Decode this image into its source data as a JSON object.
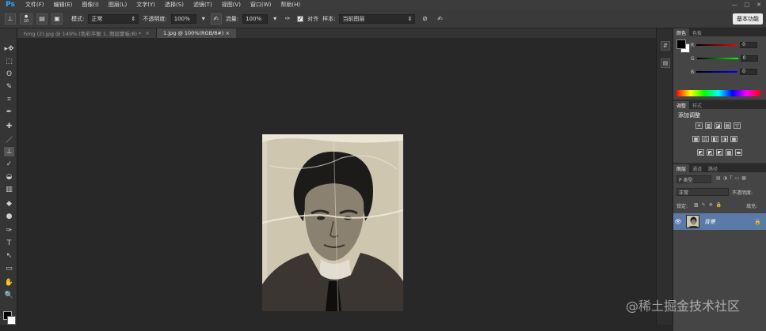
{
  "app": {
    "logo": "Ps"
  },
  "menu": {
    "items": [
      "文件(F)",
      "编辑(E)",
      "图像(I)",
      "图层(L)",
      "文字(Y)",
      "选择(S)",
      "滤镜(T)",
      "视图(V)",
      "窗口(W)",
      "帮助(H)"
    ]
  },
  "window_controls": [
    "—",
    "□",
    "✕"
  ],
  "options": {
    "brush_size": "10",
    "mode_label": "模式:",
    "mode_value": "正常",
    "opacity_label": "不透明度:",
    "opacity_value": "100%",
    "flow_label": "流量:",
    "flow_value": "100%",
    "aligned_label": "对齐",
    "sample_label": "样本:",
    "sample_value": "当前图层",
    "workspace_button": "基本功能"
  },
  "doc_tabs": [
    {
      "label": "hmg (2).jpg @ 149% (色彩平衡 1, 图层蒙板/8) *",
      "close": "×"
    },
    {
      "label": "1.jpg @ 100%(RGB/8#)",
      "close": "×"
    }
  ],
  "color_panel": {
    "tabs": [
      "颜色",
      "色板"
    ],
    "sliders": [
      {
        "channel": "R",
        "value": "0",
        "color": "#d03030"
      },
      {
        "channel": "G",
        "value": "0",
        "color": "#30b030"
      },
      {
        "channel": "B",
        "value": "0",
        "color": "#3040d0"
      }
    ]
  },
  "adjustments_panel": {
    "tabs": [
      "调整",
      "样式"
    ],
    "title": "添加调整",
    "row1": [
      "☀",
      "▥",
      "◪",
      "▤",
      "▽"
    ],
    "row2": [
      "▦",
      "⚖",
      "◧",
      "◑",
      "▦"
    ],
    "row3": [
      "◩",
      "◩",
      "◩",
      "▩",
      "▬"
    ]
  },
  "layers_panel": {
    "tabs": [
      "图层",
      "通道",
      "路径"
    ],
    "filter_label": "P 类型",
    "blend_mode": "正常",
    "opacity_label": "不透明度:",
    "lock_label": "锁定:",
    "fill_label": "填充:",
    "layer_name": "背景"
  },
  "toolbox": {
    "tools": [
      "▸✥",
      "⬚",
      "ʘ",
      "✎",
      "⌗",
      "✒",
      "✚",
      "／",
      "⊥",
      "✓",
      "◒",
      "▥",
      "◆",
      "●",
      "✑",
      "T",
      "↖",
      "▭",
      "✋",
      "🔍"
    ]
  },
  "watermark": "@稀土掘金技术社区"
}
